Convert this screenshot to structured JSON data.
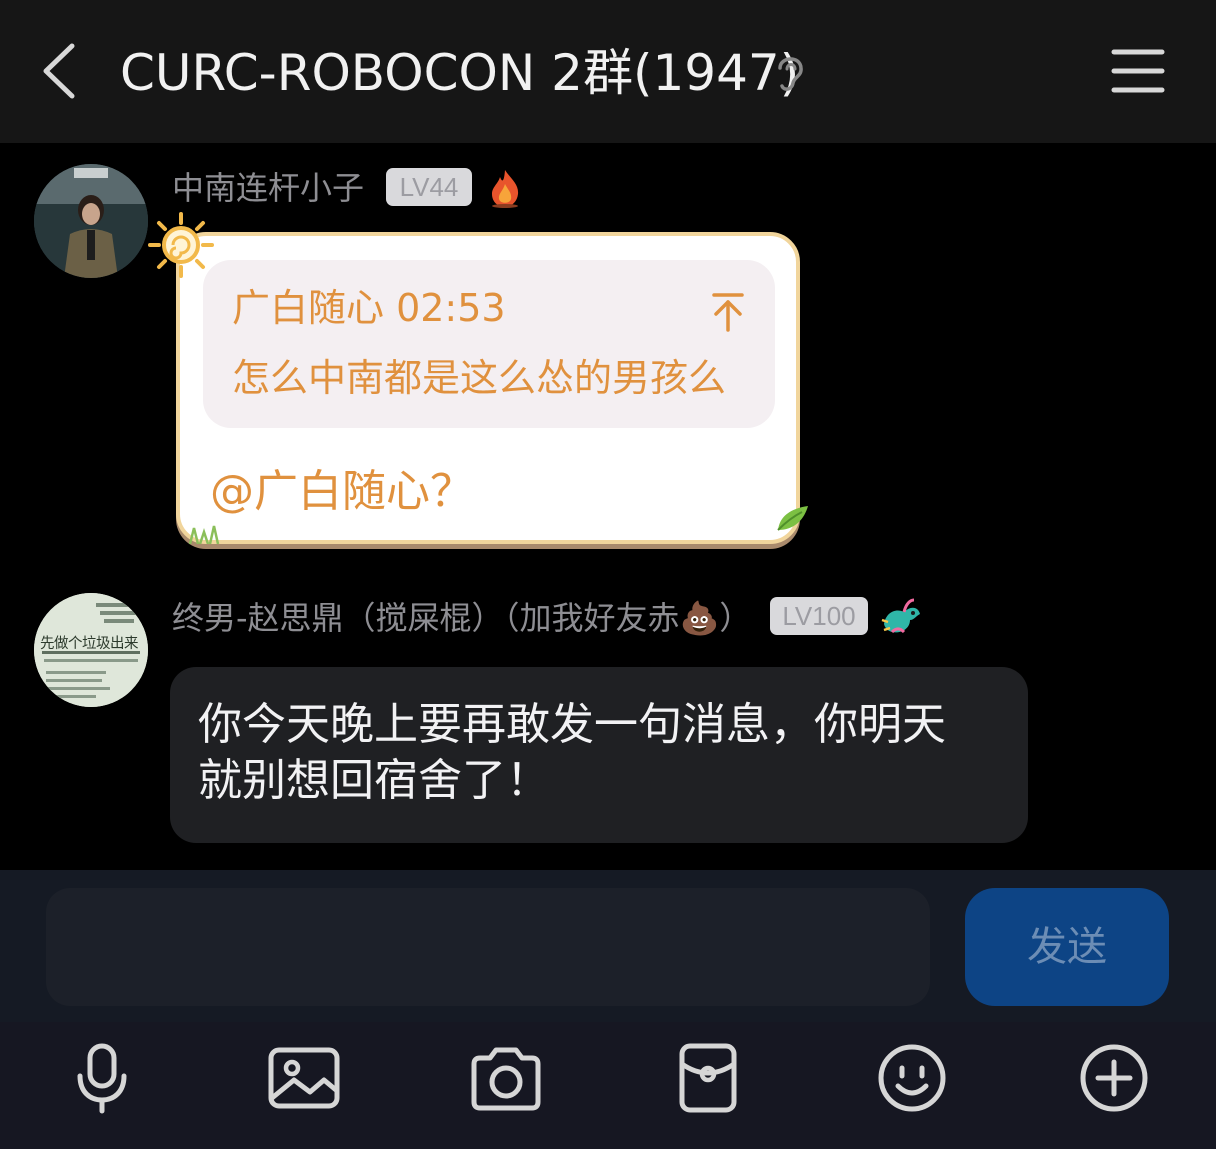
{
  "header": {
    "title": "CURC-ROBOCON 2群(1947)",
    "back_icon": "chevron-left-icon",
    "ear_icon": "ear-icon",
    "menu_icon": "hamburger-menu-icon"
  },
  "messages": [
    {
      "sender": "中南连杆小子",
      "level": "LV44",
      "badge_icon": "flame-icon",
      "quote": {
        "author": "广白随心 02:53",
        "text": "怎么中南都是这么怂的男孩么"
      },
      "text": "@广白随心？"
    },
    {
      "sender": "终男-赵思鼎（搅屎棍）（加我好友赤💩）",
      "level": "LV100",
      "badge_icon": "dragon-icon",
      "text": "你今天晚上要再敢发一句消息，你明天就别想回宿舍了！",
      "avatar_text": {
        "line1": "先做个垃圾出来"
      }
    }
  ],
  "composer": {
    "input_value": "",
    "send_label": "发送"
  },
  "toolbar": [
    "microphone-icon",
    "image-icon",
    "camera-icon",
    "red-packet-icon",
    "emoji-icon",
    "plus-icon"
  ],
  "colors": {
    "accent_orange": "#e0913e",
    "send_button": "#0d4485",
    "bubble_dark": "#1f2023"
  }
}
